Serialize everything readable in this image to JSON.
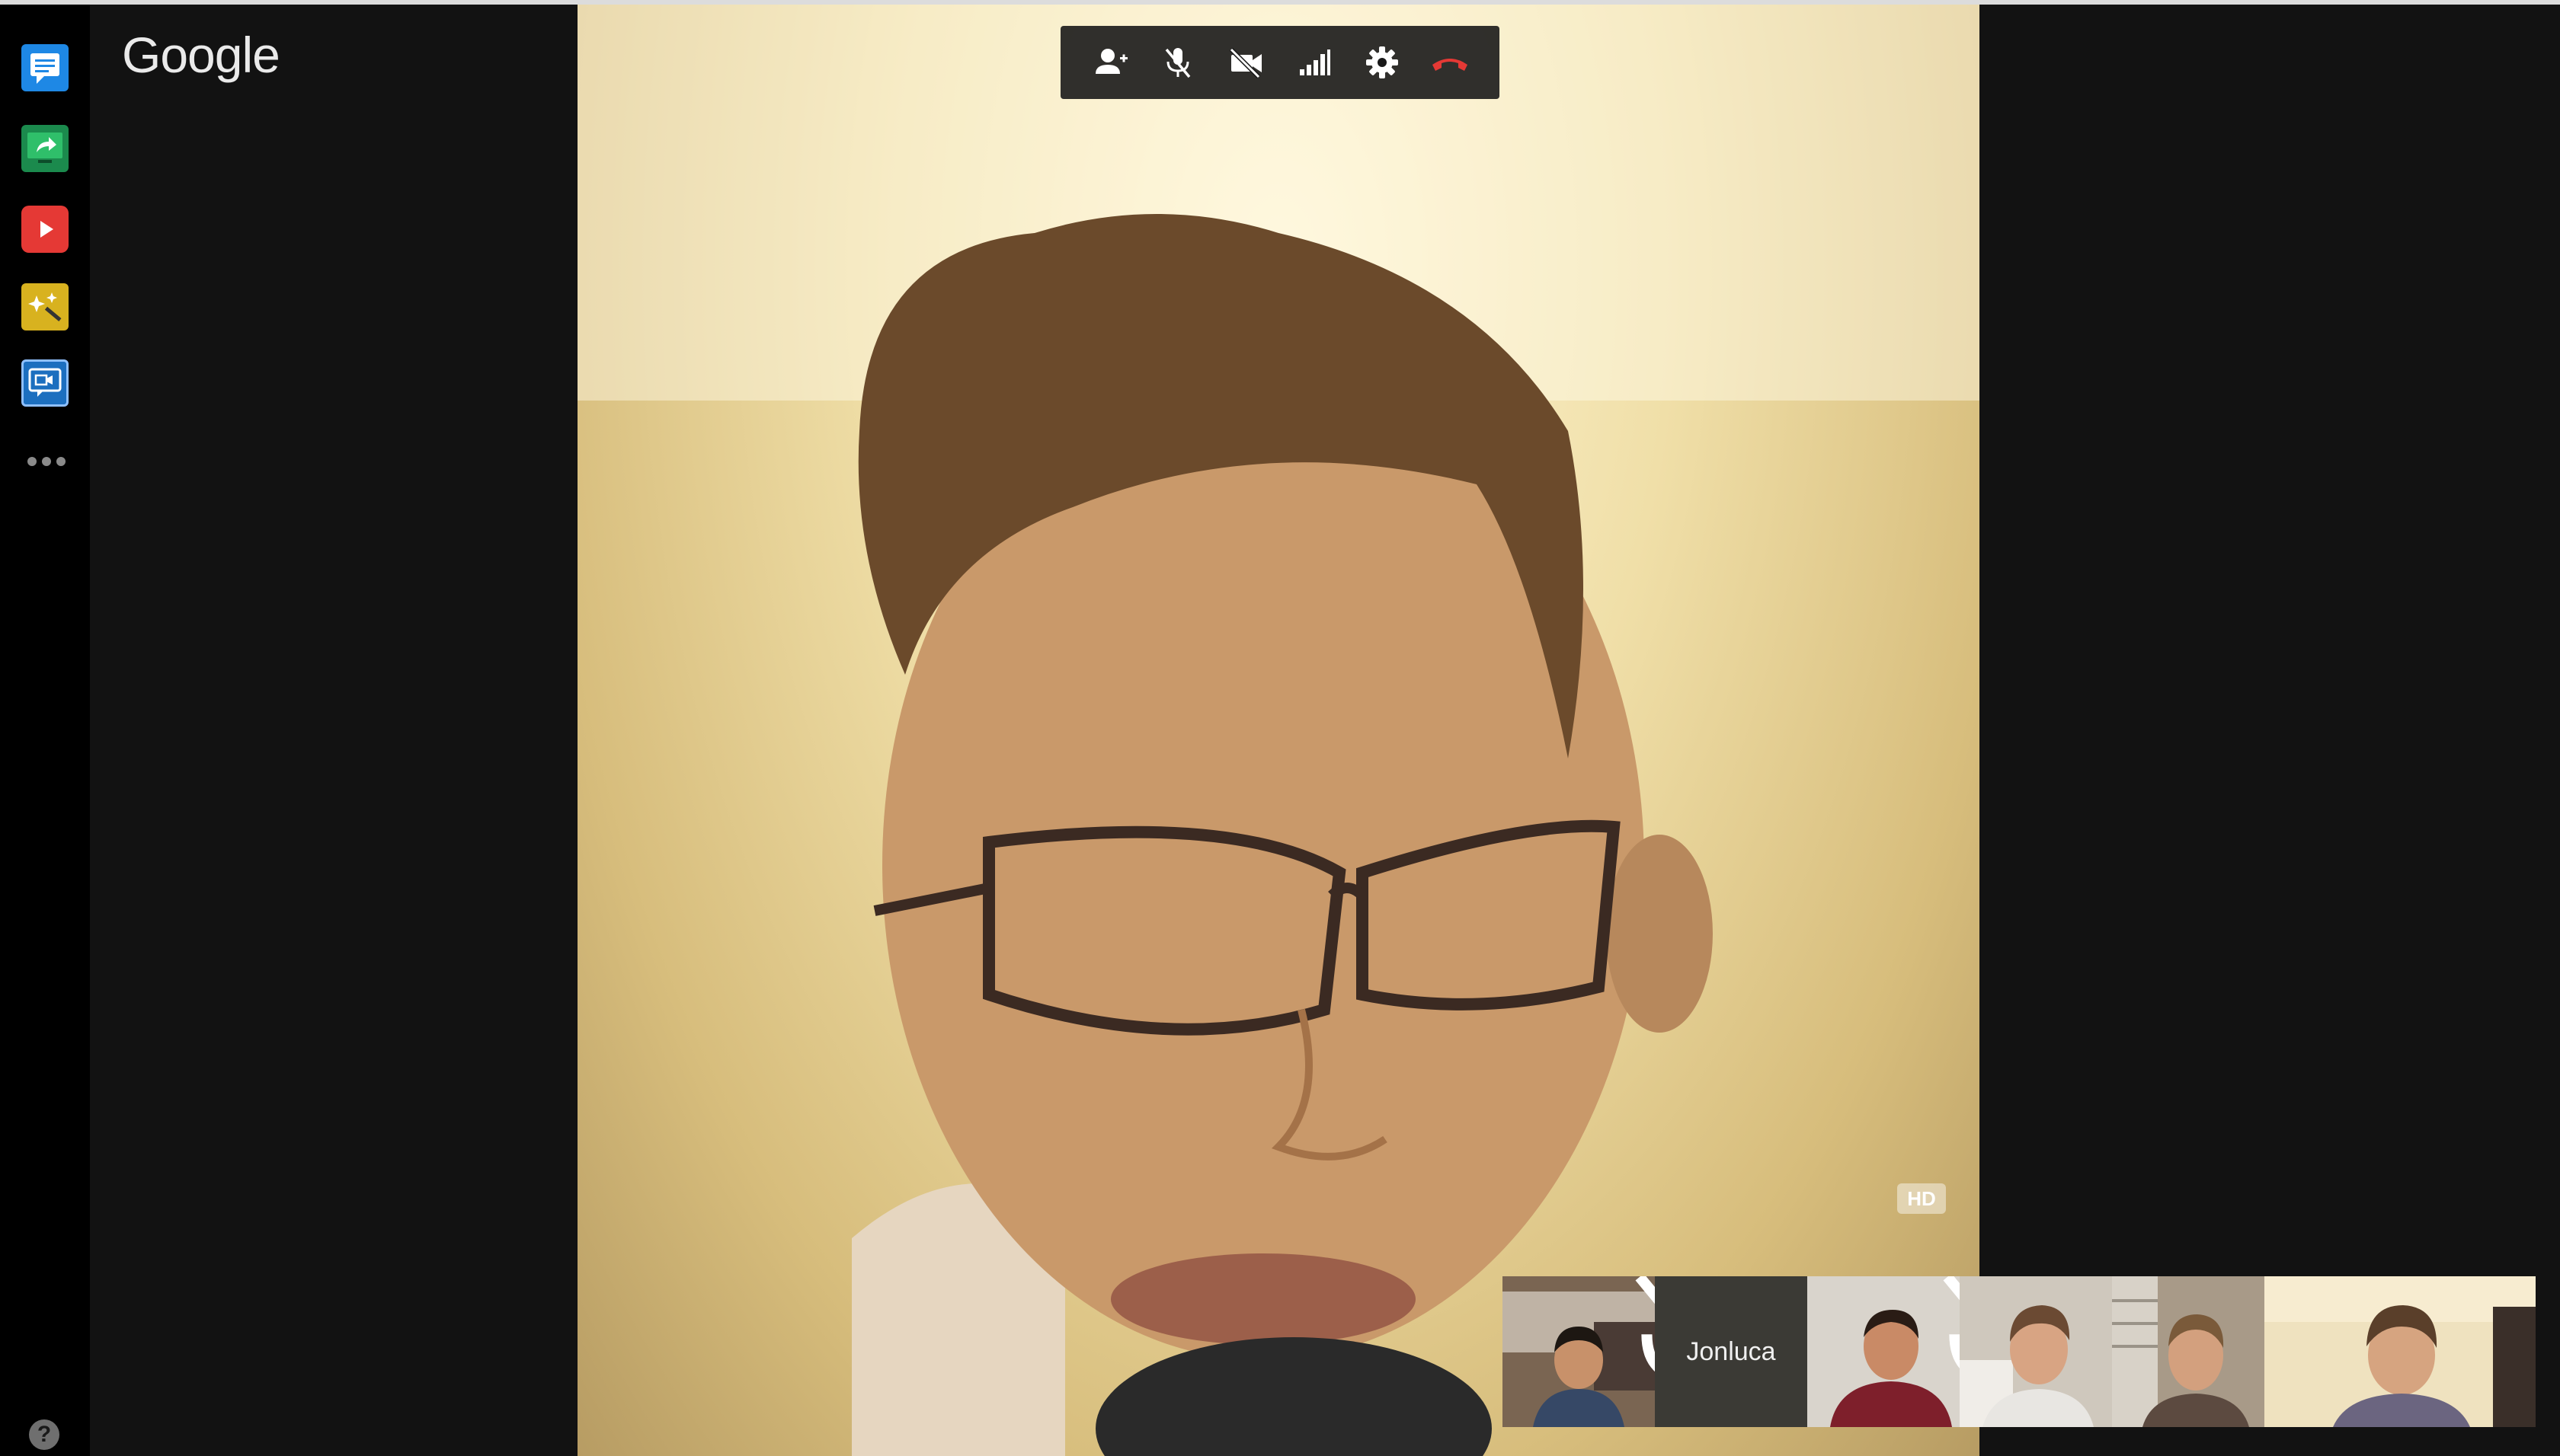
{
  "brand": {
    "logo_text": "Google"
  },
  "sidebar": {
    "apps": [
      {
        "name": "chat-icon",
        "color": "#1e88e5"
      },
      {
        "name": "screenshare-icon",
        "color": "#1b8a4d"
      },
      {
        "name": "youtube-icon",
        "color": "#e53935"
      },
      {
        "name": "effects-icon",
        "color": "#d8b21f"
      },
      {
        "name": "hangout-app-icon",
        "color": "#1c6fbf"
      }
    ],
    "more": "more-icon",
    "help": "?"
  },
  "call": {
    "controls": [
      "add-person-icon",
      "mic-off-icon",
      "camera-off-icon",
      "bandwidth-icon",
      "settings-icon",
      "hang-up-icon"
    ],
    "quality_badge": "HD",
    "participants": [
      {
        "name": "participant-1",
        "muted": true
      },
      {
        "name": "Jonluca",
        "muted": false
      },
      {
        "name": "participant-3",
        "muted": true
      },
      {
        "name": "participant-4",
        "muted": false
      },
      {
        "name": "participant-5",
        "muted": false
      },
      {
        "name": "participant-6",
        "muted": false
      }
    ]
  }
}
